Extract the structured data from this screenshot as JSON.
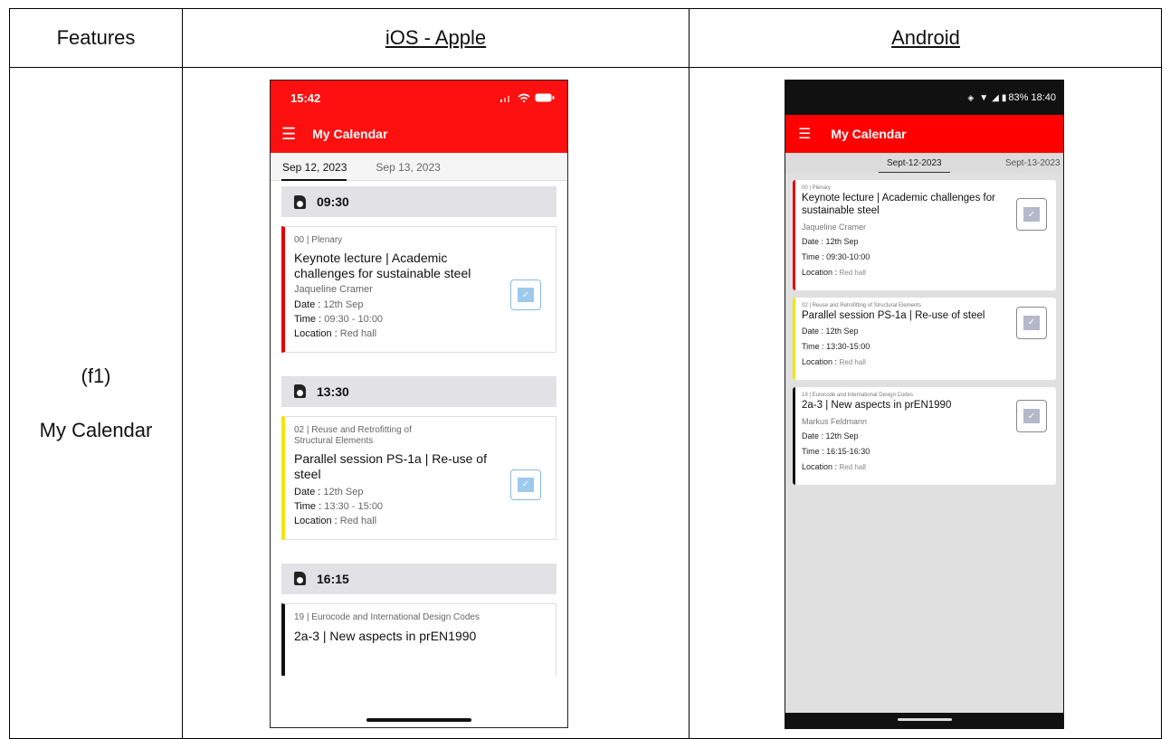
{
  "table": {
    "headers": {
      "features": "Features",
      "ios": "iOS - Apple",
      "android": "Android"
    },
    "feature": {
      "code": "(f1)",
      "name": "My Calendar"
    }
  },
  "ios": {
    "status_time": "15:42",
    "app_title": "My Calendar",
    "tabs": [
      "Sep 12, 2023",
      "Sep 13, 2023"
    ],
    "slots": [
      {
        "time": "09:30",
        "card": {
          "track": "00 | Plenary",
          "title": "Keynote lecture | Academic challenges for sustainable steel",
          "speaker": "Jaqueline Cramer",
          "date_label": "Date : ",
          "date": "12th Sep",
          "time_label": "Time : ",
          "time": "09:30 - 10:00",
          "loc_label": "Location : ",
          "location": "Red hall",
          "accent": "#e30000"
        }
      },
      {
        "time": "13:30",
        "card": {
          "track": "02 | Reuse and Retrofitting of Structural Elements",
          "title": "Parallel session PS-1a | Re-use of steel",
          "date_label": "Date : ",
          "date": "12th Sep",
          "time_label": "Time : ",
          "time": "13:30 - 15:00",
          "loc_label": "Location : ",
          "location": "Red hall",
          "accent": "#f2e60a"
        }
      },
      {
        "time": "16:15",
        "card": {
          "track": "19 | Eurocode and International Design Codes",
          "title": "2a-3 | New aspects in prEN1990",
          "accent": "#111111"
        }
      }
    ]
  },
  "android": {
    "status_text": "83% 18:40",
    "app_title": "My Calendar",
    "tabs": [
      "Sept-12-2023",
      "Sept-13-2023"
    ],
    "cards": [
      {
        "track": "00 | Plenary",
        "title": "Keynote lecture | Academic challenges for sustainable steel",
        "speaker": "Jaqueline Cramer",
        "date": "Date : 12th Sep",
        "time": "Time : 09:30-10:00",
        "loc_label": "Location : ",
        "location": "Red hall",
        "accent": "#e30000"
      },
      {
        "track": "02 | Reuse and Retrofitting of Structural Elements",
        "title": "Parallel session PS-1a | Re-use of steel",
        "date": "Date : 12th Sep",
        "time": "Time : 13:30-15:00",
        "loc_label": "Location : ",
        "location": "Red hall",
        "accent": "#f2e60a"
      },
      {
        "track": "19 | Eurocode and International Design Codes",
        "title": "2a-3 | New aspects in prEN1990",
        "speaker": "Markus Feldmann",
        "date": "Date : 12th Sep",
        "time": "Time : 16:15-16:30",
        "loc_label": "Location : ",
        "location": "Red hall",
        "accent": "#111111"
      }
    ]
  }
}
